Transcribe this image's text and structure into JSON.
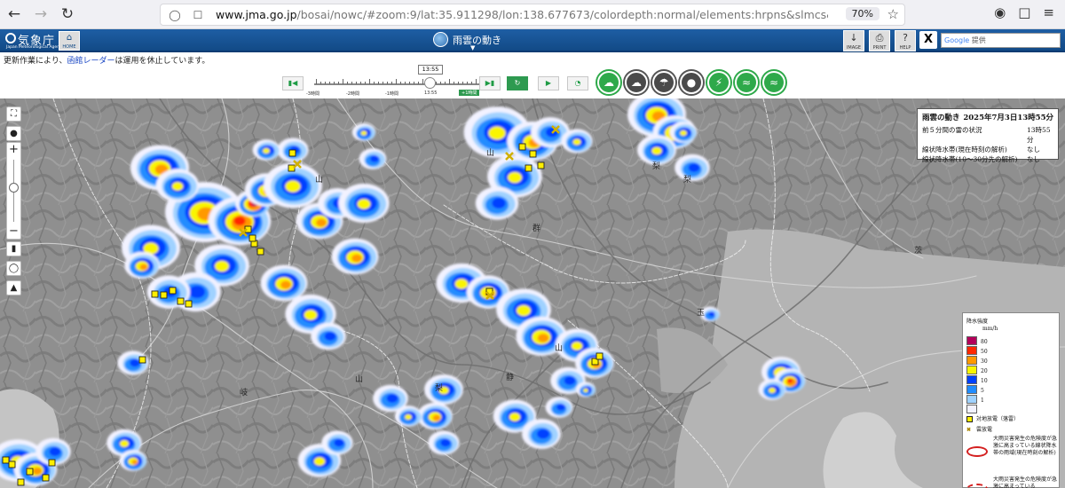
{
  "browser": {
    "url_domain": "www.jma.go.jp",
    "url_path": "/bosai/nowc/#zoom:9/lat:35.911298/lon:138.677673/colordepth:normal/elements:hrpns&slmcs&slmcs_fcst&liden",
    "zoom": "70%"
  },
  "header": {
    "logo_text": "気象庁",
    "logo_sub": "Japan Meteorological Agency",
    "home_label": "HOME",
    "title": "雨雲の動き",
    "image_label": "IMAGE",
    "print_label": "PRINT",
    "help_label": "HELP",
    "search_brand": "Google",
    "search_placeholder": "提供"
  },
  "notice": {
    "prefix": "更新作業により、",
    "link": "函館レーダー",
    "suffix": "は運用を休止しています。"
  },
  "timeline": {
    "current_time": "13:55",
    "labels": [
      "-3時間",
      "-2時間",
      "-1時間",
      "13:55",
      "+1時間"
    ]
  },
  "info": {
    "title": "雨雲の動き",
    "date": "2025年7月3日13時55分",
    "rows": [
      {
        "label": "前５分間の雷の状況",
        "value": "13時55分"
      },
      {
        "label": "線状降水帯(現在時刻の解析)",
        "value": "なし"
      },
      {
        "label": "線状降水帯(10〜30分先の解析)",
        "value": "なし"
      }
    ]
  },
  "legend": {
    "title": "降水強度",
    "unit": "mm/h",
    "levels": [
      {
        "label": "80",
        "color": "#b4005a"
      },
      {
        "label": "50",
        "color": "#ff2800"
      },
      {
        "label": "30",
        "color": "#ff9900"
      },
      {
        "label": "20",
        "color": "#faf500"
      },
      {
        "label": "10",
        "color": "#0041ff"
      },
      {
        "label": "5",
        "color": "#218cff"
      },
      {
        "label": "1",
        "color": "#a0d2ff"
      },
      {
        "label": "",
        "color": "#f2f2ff"
      }
    ],
    "lightning_ground": "対地放電（落雷）",
    "lightning_cloud": "雲放電",
    "risk_current": "大雨災害発生の危険度が急激に高まっている線状降水帯の雨域(現在時刻の解析)",
    "risk_forecast": "大雨災害発生の危険度が急激に高まっている"
  },
  "map": {
    "labels": [
      "山",
      "山",
      "梨",
      "梨",
      "玉",
      "山",
      "群",
      "茨",
      "岐",
      "山",
      "梨",
      "静"
    ]
  }
}
